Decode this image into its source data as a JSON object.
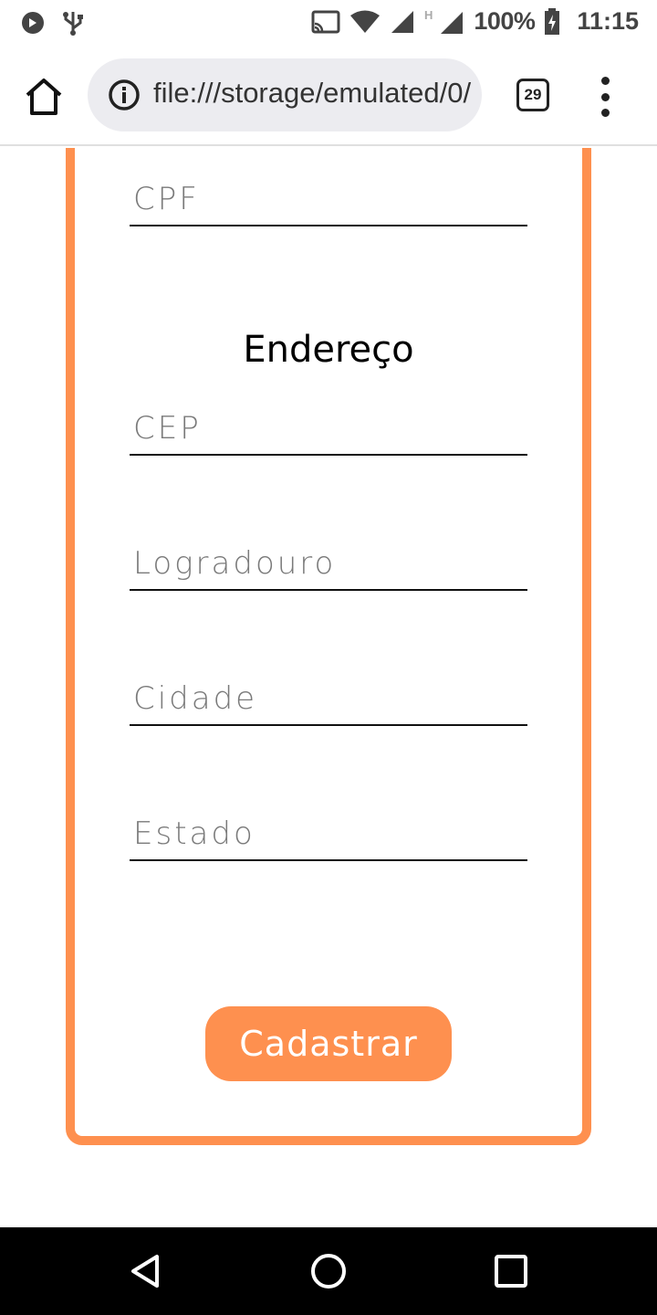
{
  "status_bar": {
    "battery": "100%",
    "time": "11:15",
    "icons": [
      "notification-icon",
      "usb-icon",
      "cast-icon",
      "wifi-icon",
      "signal-icon",
      "signal-h-icon",
      "battery-charging-icon"
    ]
  },
  "toolbar": {
    "url": "file:///storage/emulated/0/",
    "tab_count": "29"
  },
  "form": {
    "cpf_placeholder": "CPF",
    "address_title": "Endereço",
    "cep_placeholder": "CEP",
    "logradouro_placeholder": "Logradouro",
    "cidade_placeholder": "Cidade",
    "estado_placeholder": "Estado",
    "submit_label": "Cadastrar"
  },
  "colors": {
    "accent": "#fe904f"
  }
}
